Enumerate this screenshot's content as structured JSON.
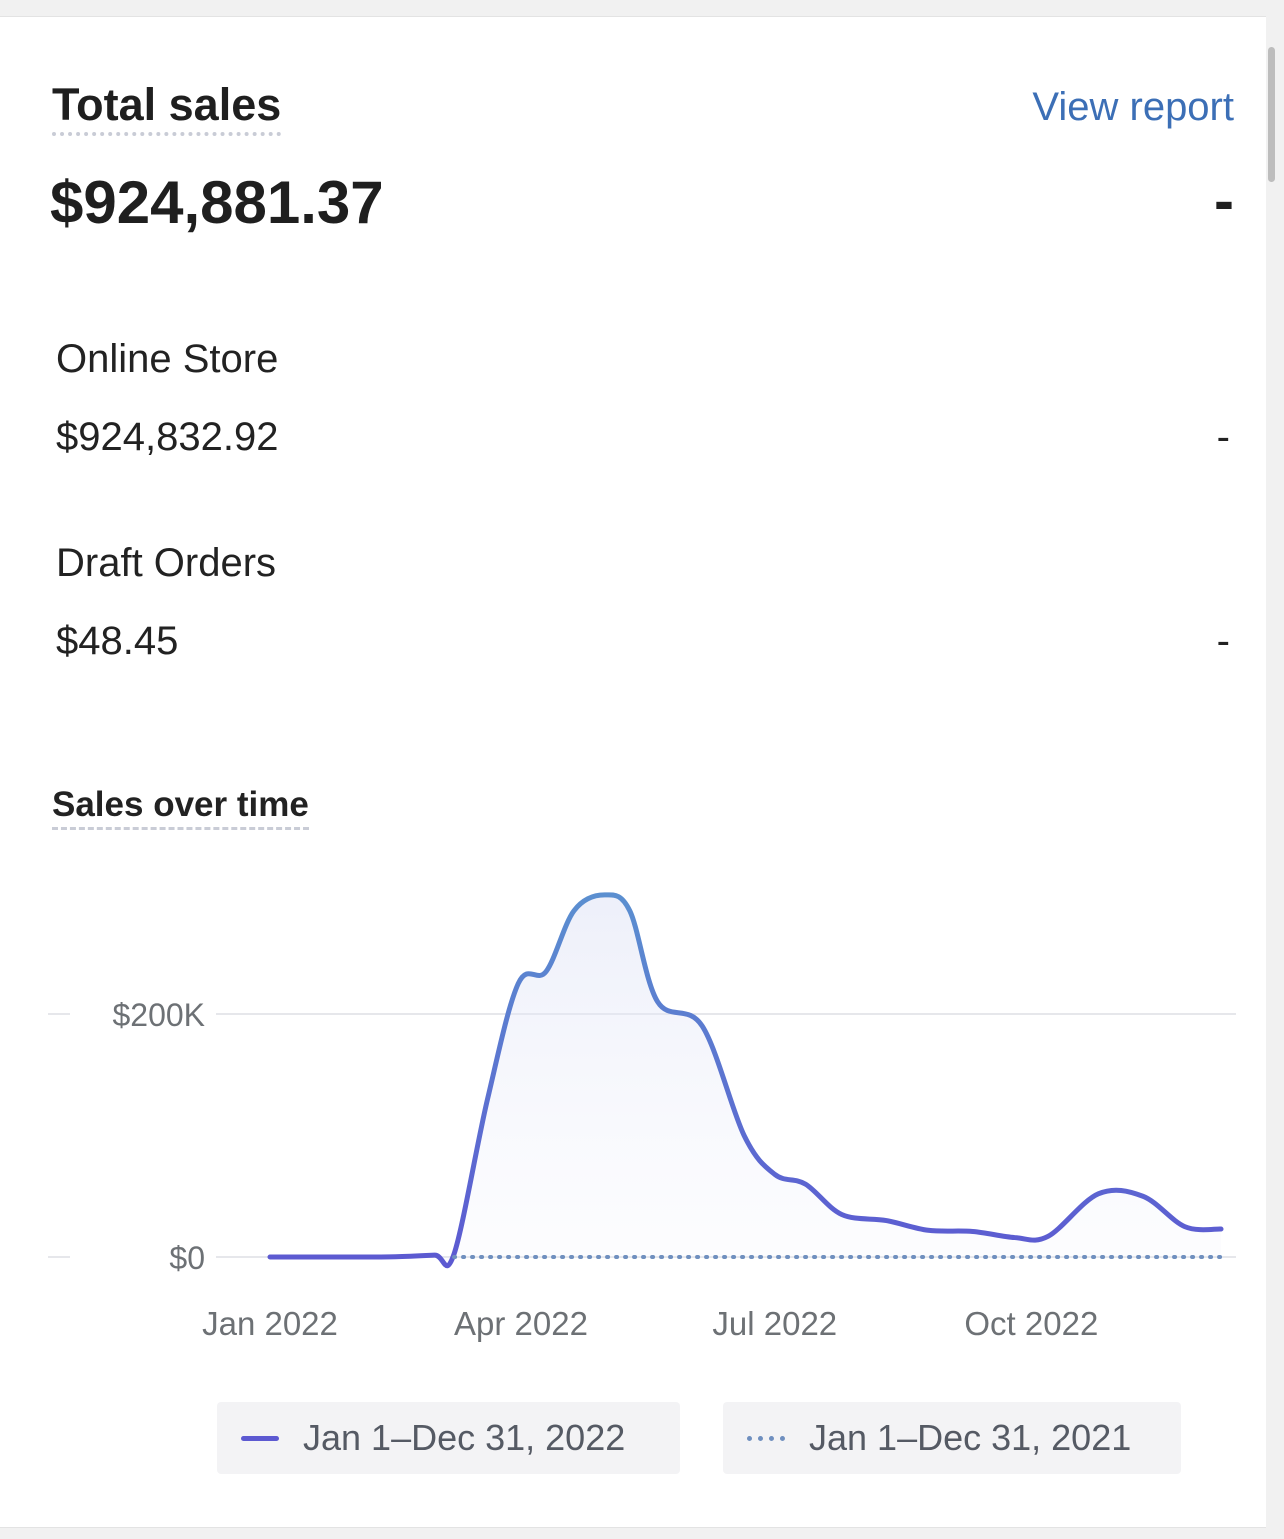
{
  "card": {
    "title": "Total sales",
    "view_report": "View report",
    "total_value": "$924,881.37",
    "total_change": "-"
  },
  "breakdown": [
    {
      "name": "Online Store",
      "value": "$924,832.92",
      "change": "-"
    },
    {
      "name": "Draft Orders",
      "value": "$48.45",
      "change": "-"
    }
  ],
  "chart_data": {
    "type": "area",
    "title": "Sales over time",
    "y_ticks": [
      {
        "value": 0,
        "label": "$0"
      },
      {
        "value": 200000,
        "label": "$200K"
      }
    ],
    "x_ticks": [
      {
        "date": "2022-01-01",
        "label": "Jan 2022"
      },
      {
        "date": "2022-04-01",
        "label": "Apr 2022"
      },
      {
        "date": "2022-07-01",
        "label": "Jul 2022"
      },
      {
        "date": "2022-10-01",
        "label": "Oct 2022"
      }
    ],
    "ylim": [
      0,
      200000
    ],
    "grid": true,
    "legend_position": "bottom",
    "series": [
      {
        "name": "Jan 1–Dec 31, 2022",
        "style": "solid",
        "color": "#5c59d1",
        "color_top": "#5b8fd0",
        "points": [
          [
            "2022-01-01",
            0
          ],
          [
            "2022-01-15",
            0
          ],
          [
            "2022-02-01",
            0
          ],
          [
            "2022-02-15",
            200
          ],
          [
            "2022-03-01",
            1500
          ],
          [
            "2022-03-08",
            2500
          ],
          [
            "2022-03-20",
            130000
          ],
          [
            "2022-03-31",
            225000
          ],
          [
            "2022-04-10",
            235000
          ],
          [
            "2022-04-20",
            285000
          ],
          [
            "2022-05-01",
            298000
          ],
          [
            "2022-05-10",
            285000
          ],
          [
            "2022-05-20",
            210000
          ],
          [
            "2022-06-05",
            190000
          ],
          [
            "2022-06-20",
            100000
          ],
          [
            "2022-07-01",
            68000
          ],
          [
            "2022-07-12",
            60000
          ],
          [
            "2022-07-25",
            35000
          ],
          [
            "2022-08-10",
            30000
          ],
          [
            "2022-08-25",
            22000
          ],
          [
            "2022-09-10",
            21000
          ],
          [
            "2022-09-25",
            16000
          ],
          [
            "2022-10-07",
            17000
          ],
          [
            "2022-10-25",
            52000
          ],
          [
            "2022-11-10",
            50000
          ],
          [
            "2022-11-25",
            25000
          ],
          [
            "2022-12-08",
            23000
          ]
        ]
      },
      {
        "name": "Jan 1–Dec 31, 2021",
        "style": "dotted",
        "color": "#6f8fbf",
        "points": [
          [
            "2022-03-08",
            0
          ],
          [
            "2022-12-08",
            0
          ]
        ]
      }
    ]
  }
}
